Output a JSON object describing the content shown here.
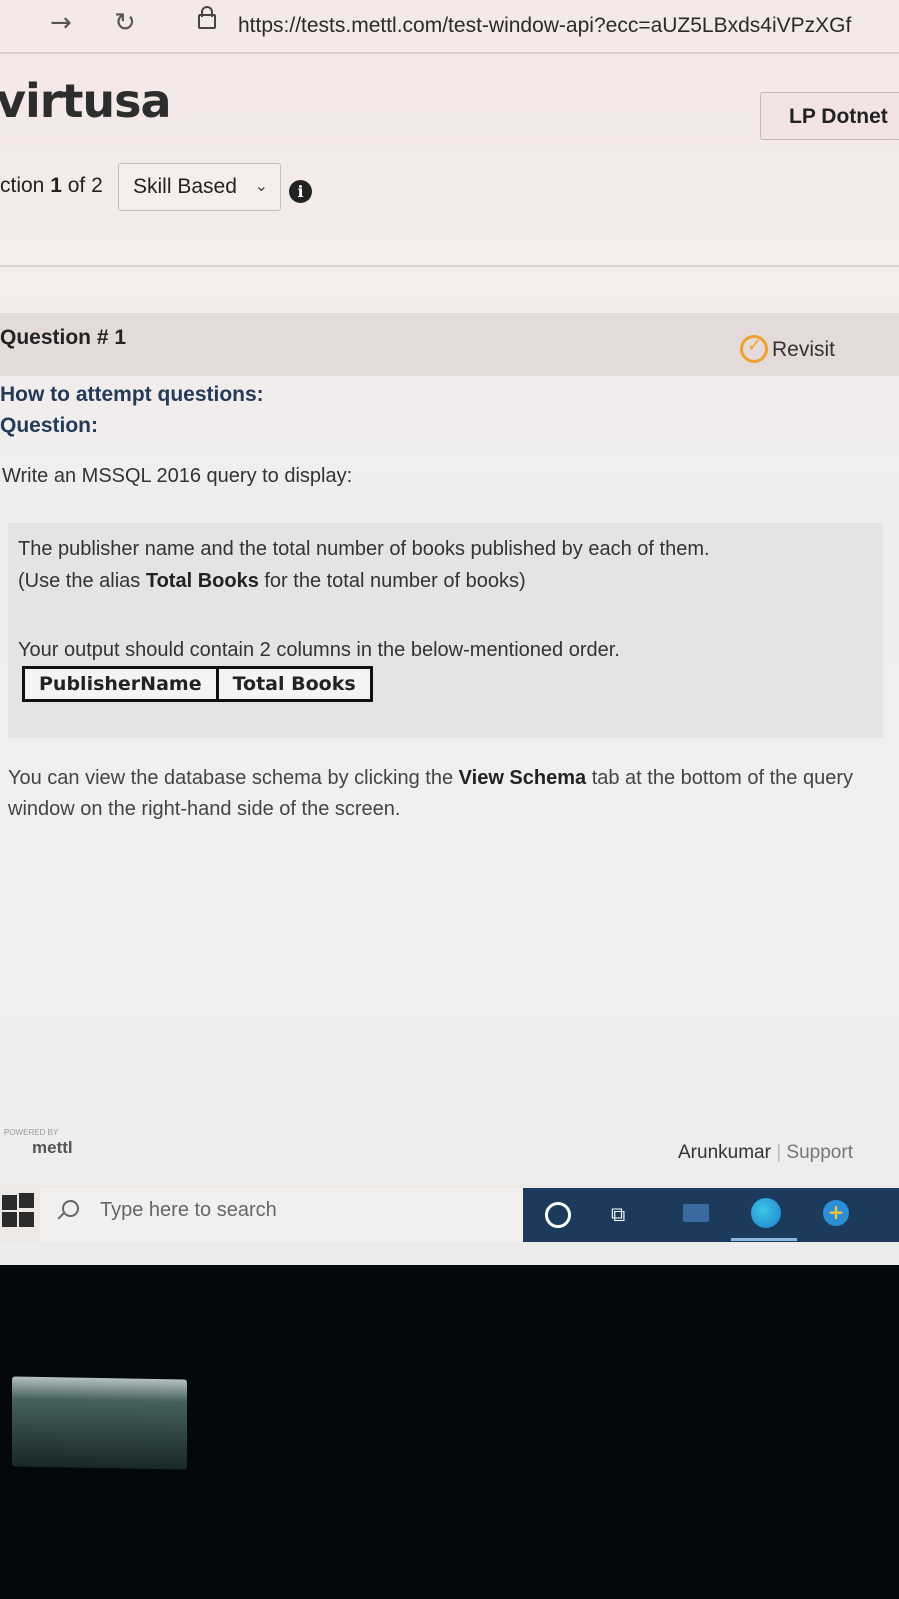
{
  "browser": {
    "url": "https://tests.mettl.com/test-window-api?ecc=aUZ5LBxds4iVPzXGf",
    "forward_icon": "arrow-right-icon",
    "reload_icon": "reload-icon",
    "lock_icon": "lock-icon"
  },
  "header": {
    "logo": "virtusa",
    "test_name": "LP Dotnet"
  },
  "section": {
    "prefix": "ction",
    "current": "1",
    "of_text": "of 2",
    "select_value": "Skill Based",
    "info_icon": "info-icon"
  },
  "question": {
    "number_label": "Question # 1",
    "revisit_label": "Revisit",
    "how_to": "How to attempt questions:",
    "question_label": "Question:",
    "intro": "Write an MSSQL 2016 query to display:",
    "line1": "The publisher name and the total number of books published by each of them.",
    "line2_pre": "(Use the alias ",
    "line2_bold": "Total Books",
    "line2_post": " for the total number of books)",
    "output_text": "Your output should contain 2 columns in the below-mentioned order.",
    "columns": [
      "PublisherName",
      "Total Books"
    ],
    "schema_pre": "You can view the database schema by clicking the ",
    "schema_bold": "View Schema",
    "schema_post": " tab at the bottom of the query window on the right-hand side of the screen."
  },
  "footer": {
    "powered_by": "POWERED BY",
    "brand": "mettl",
    "user": "Arunkumar",
    "separator": "|",
    "support": "Support"
  },
  "taskbar": {
    "search_placeholder": "Type here to search",
    "colors": {
      "tray": "#1b3a5c",
      "search_bg": "#f2f0ee"
    }
  }
}
